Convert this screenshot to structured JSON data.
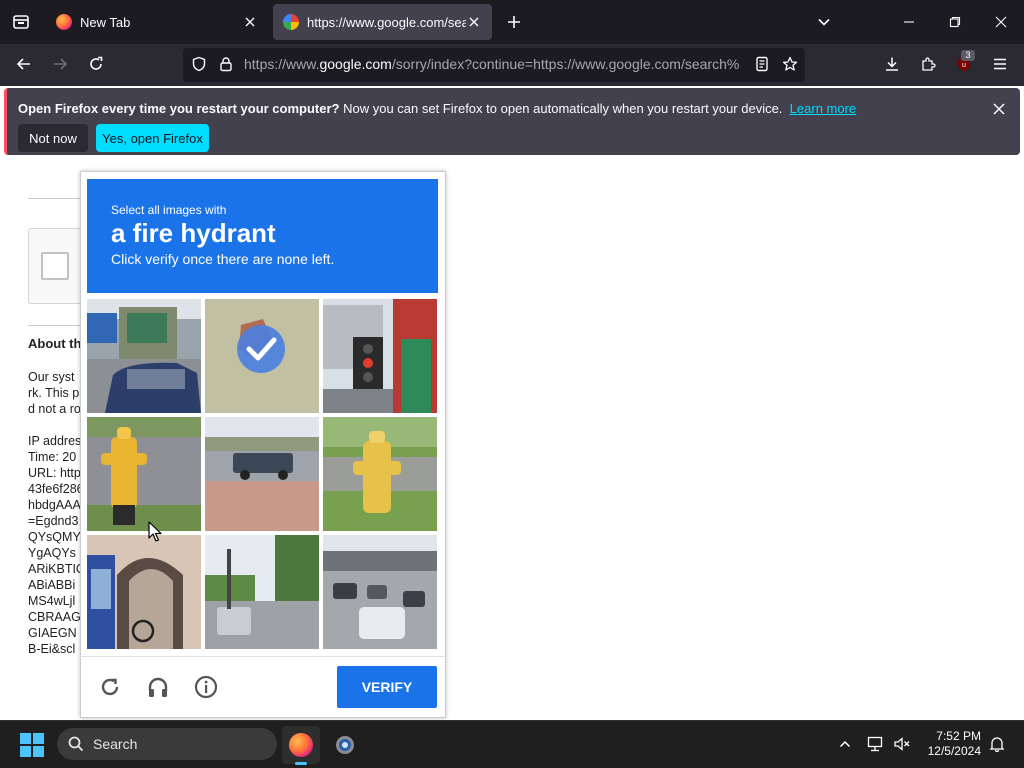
{
  "browser": {
    "tabs": [
      {
        "title": "New Tab",
        "active": false
      },
      {
        "title": "https://www.google.com/search?q=...",
        "active": true
      }
    ],
    "url": {
      "prefix": "https://www.",
      "host": "google.com",
      "rest": "/sorry/index?continue=https://www.google.com/search%..."
    },
    "extension_badge": "3"
  },
  "notification": {
    "bold": "Open Firefox every time you restart your computer?",
    "message": " Now you can set Firefox to open automatically when you restart your device.",
    "link": "Learn more",
    "not_now": "Not now",
    "yes": "Yes, open Firefox"
  },
  "page": {
    "about_title": "About th",
    "lines": [
      "Our syst",
      "rk. This p",
      "d not a ro",
      "",
      "IP addres",
      "Time: 20",
      "URL: http",
      "43fe6f286",
      "hbdgAAA",
      "=Egdnd3",
      "QYsQMY",
      "YgAQYs",
      "ARiKBTIO",
      "ABiABBi",
      "MS4wLjl",
      "CBRAAG",
      "GIAEGN",
      "B-Ei&scl"
    ]
  },
  "captcha": {
    "line1": "Select all images with",
    "target": "a fire hydrant",
    "line3": "Click verify once there are none left.",
    "verify": "VERIFY",
    "tiles": [
      {
        "scene": "street-car",
        "selected": false
      },
      {
        "scene": "hydrant-top",
        "selected": true
      },
      {
        "scene": "traffic-light",
        "selected": false
      },
      {
        "scene": "yellow-hydrant",
        "selected": false
      },
      {
        "scene": "truck-road",
        "selected": false
      },
      {
        "scene": "yellow-hydrant-grass",
        "selected": false
      },
      {
        "scene": "archway",
        "selected": false
      },
      {
        "scene": "street-trees",
        "selected": false
      },
      {
        "scene": "traffic-cars",
        "selected": false
      }
    ]
  },
  "taskbar": {
    "search_placeholder": "Search",
    "time": "7:52 PM",
    "date": "12/5/2024"
  },
  "colors": {
    "captcha_blue": "#1a73e8",
    "accent_cyan": "#00ddff",
    "chrome_dark": "#1c1b22"
  }
}
